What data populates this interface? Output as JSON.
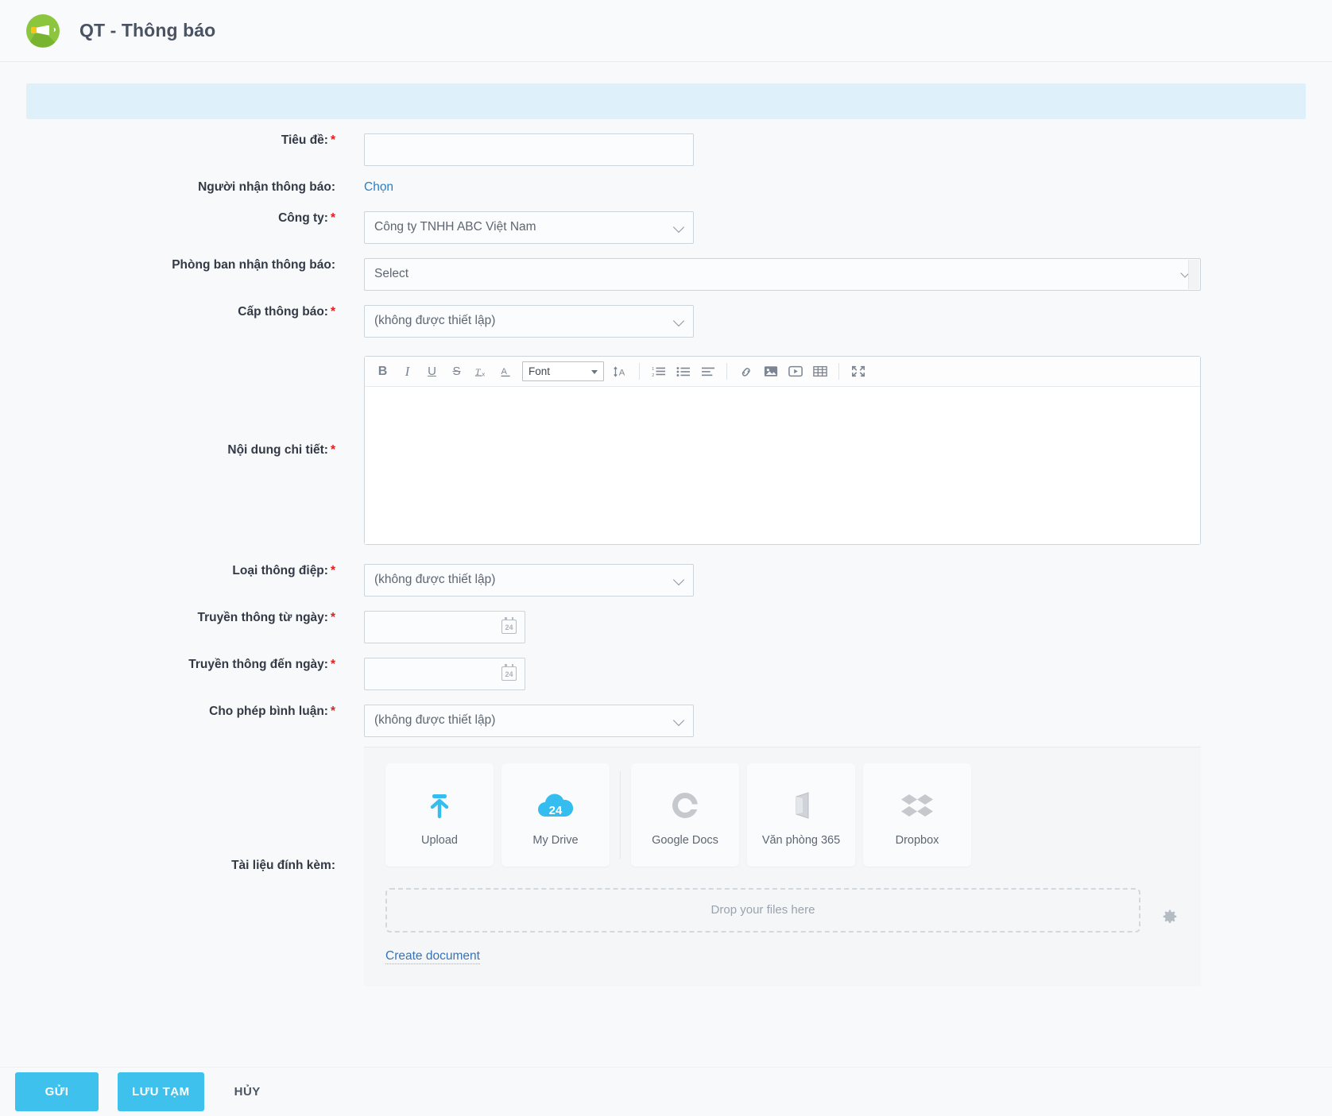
{
  "header": {
    "title": "QT - Thông báo",
    "logo_icon": "megaphone-icon"
  },
  "form": {
    "title_label": "Tiêu đề:",
    "title_value": "",
    "recipient_label": "Người nhận thông báo:",
    "recipient_link": "Chọn",
    "company_label": "Công ty:",
    "company_value": "Công ty TNHH ABC Việt Nam",
    "department_label": "Phòng ban nhận thông báo:",
    "department_value": "Select",
    "level_label": "Cấp thông báo:",
    "level_value": "(không được thiết lập)",
    "content_label": "Nội dung chi tiết:",
    "content_value": "",
    "message_type_label": "Loại thông điệp:",
    "message_type_value": "(không được thiết lập)",
    "from_date_label": "Truyền thông từ ngày:",
    "from_date_value": "",
    "to_date_label": "Truyền thông đến ngày:",
    "to_date_value": "",
    "comment_label": "Cho phép bình luận:",
    "comment_value": "(không được thiết lập)",
    "attachment_label": "Tài liệu đính kèm:",
    "required_mark": "*"
  },
  "editor": {
    "font_select_value": "Font",
    "buttons": [
      {
        "name": "bold-icon",
        "glyph": "B"
      },
      {
        "name": "italic-icon",
        "glyph": "I"
      },
      {
        "name": "underline-icon",
        "glyph": "U"
      },
      {
        "name": "strikethrough-icon",
        "glyph": "S"
      },
      {
        "name": "remove-format-icon",
        "glyph": "Tx"
      },
      {
        "name": "text-color-icon",
        "glyph": "A"
      },
      {
        "name": "font-size-icon",
        "glyph": "A"
      },
      {
        "name": "numbered-list-icon",
        "glyph": "1."
      },
      {
        "name": "bullet-list-icon",
        "glyph": "•"
      },
      {
        "name": "align-icon",
        "glyph": "≡"
      },
      {
        "name": "link-icon",
        "glyph": "link"
      },
      {
        "name": "image-icon",
        "glyph": "image"
      },
      {
        "name": "video-icon",
        "glyph": "video"
      },
      {
        "name": "table-icon",
        "glyph": "table"
      },
      {
        "name": "fullscreen-icon",
        "glyph": "expand"
      }
    ]
  },
  "attachments": {
    "tiles": [
      {
        "label": "Upload",
        "icon": "upload-icon"
      },
      {
        "label": "My Drive",
        "icon": "my-drive-cloud-icon"
      },
      {
        "label": "Google Docs",
        "icon": "google-docs-icon"
      },
      {
        "label": "Văn phòng 365",
        "icon": "office-365-icon"
      },
      {
        "label": "Dropbox",
        "icon": "dropbox-icon"
      }
    ],
    "dropzone_text": "Drop your files here",
    "settings_icon": "gear-icon",
    "create_document_link": "Create document",
    "drive_badge": "24"
  },
  "footer": {
    "submit_label": "GỬI",
    "save_draft_label": "LƯU TẠM",
    "cancel_label": "HỦY"
  },
  "colors": {
    "accent": "#3ec1ec",
    "link": "#2a7fc4",
    "required": "#e02020",
    "banner": "#def1fa",
    "logo_green": "#8cc63f"
  }
}
